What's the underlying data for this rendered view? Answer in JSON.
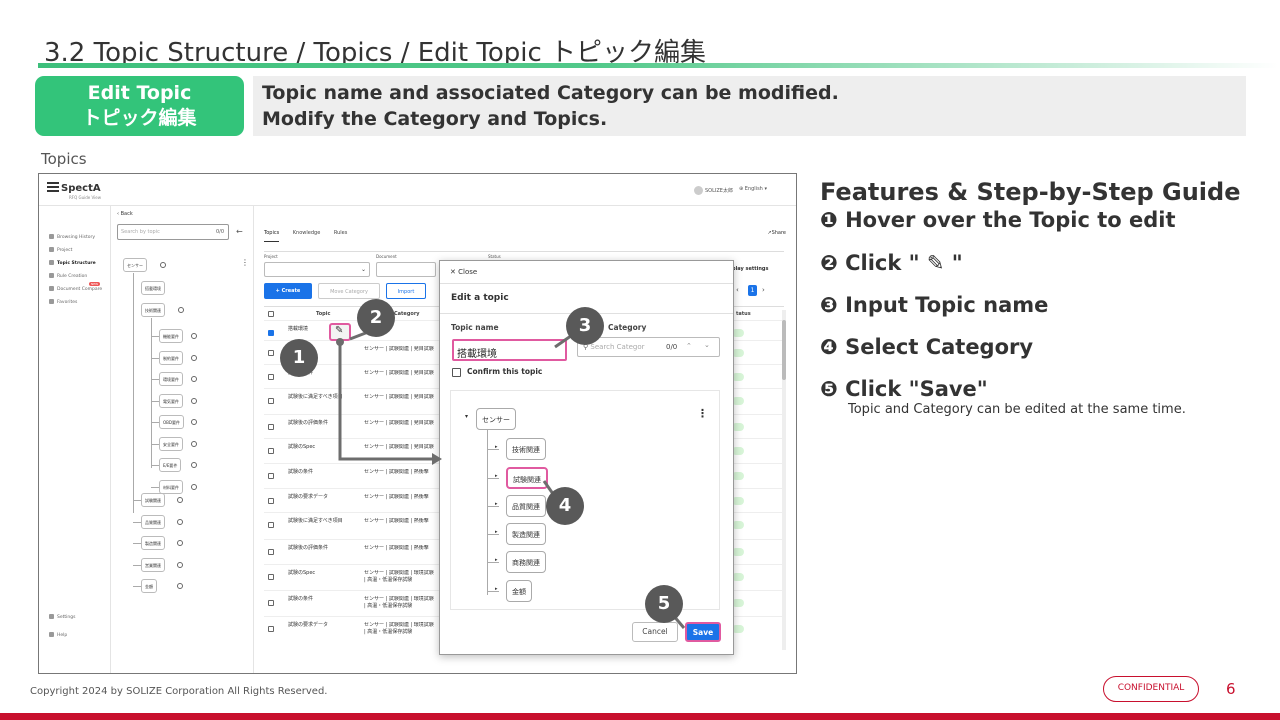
{
  "slide": {
    "title": "3.2 Topic Structure / Topics / Edit Topic トピック編集",
    "badge_line1": "Edit Topic",
    "badge_line2": "トピック編集",
    "desc_line1": "Topic name and associated Category can be modified.",
    "desc_line2": "Modify the Category and Topics.",
    "topics_label": "Topics",
    "copyright": "Copyright 2024 by SOLIZE Corporation All Rights Reserved.",
    "confidential": "CONFIDENTIAL",
    "page_number": "6",
    "accent_color": "#33c47a",
    "brand_red": "#c8102e"
  },
  "guide": {
    "heading": "Features & Step-by-Step Guide",
    "steps": [
      "❶ Hover over the Topic to edit",
      "❷ Click \" ✎ \"",
      "❸ Input Topic name",
      "❹ Select Category",
      "❺ Click \"Save\""
    ],
    "note": "Topic and Category can be edited at the same time."
  },
  "app": {
    "logo": "SpectA",
    "logo_sub": "RFQ Guide View",
    "user": "SOLIZE太郎",
    "language": "English",
    "back": "Back",
    "search_placeholder": "Search by topic",
    "search_count": "0/0",
    "sidebar": [
      "Browsing History",
      "Project",
      "Topic Structure",
      "Rule Creation",
      "Document Compare",
      "Favorites"
    ],
    "sidebar_new": "NEW",
    "settings": "Settings",
    "help": "Help",
    "tree_root": "センサー",
    "tree_l1": "搭載環境",
    "tree_l2": "技術関連",
    "tree_l3": [
      "機能要件",
      "制約要件",
      "環境要件",
      "電気要件",
      "OBD要件",
      "安全要件",
      "E/E要件",
      "材料要件"
    ],
    "tree_l2b": [
      "試験関連",
      "品質関連",
      "製造関連",
      "営業関連",
      "金額"
    ],
    "tabs": [
      "Topics",
      "Knowledge",
      "Rules"
    ],
    "share": "Share",
    "filter_labels": [
      "Project",
      "Document",
      "Status"
    ],
    "create": "Create",
    "move_category": "Move Category",
    "import": "Import",
    "display_settings": "play settings",
    "page": "1",
    "col_topic": "Topic",
    "col_category": "Category",
    "col_status": "tatus",
    "rows": [
      {
        "topic": "搭載環境",
        "category": ""
      },
      {
        "topic": "",
        "category": "センサー | 試験関連 | 発目試験"
      },
      {
        "topic": "試験の条件",
        "category": "センサー | 試験関連 | 発目試験"
      },
      {
        "topic": "試験後に満足すべき項目",
        "category": "センサー | 試験関連 | 発目試験"
      },
      {
        "topic": "試験後の評価条件",
        "category": "センサー | 試験関連 | 発目試験"
      },
      {
        "topic": "試験のSpec",
        "category": "センサー | 試験関連 | 発目試験"
      },
      {
        "topic": "試験の条件",
        "category": "センサー | 試験関連 | 熱衝撃"
      },
      {
        "topic": "試験の要求データ",
        "category": "センサー | 試験関連 | 熱衝撃"
      },
      {
        "topic": "試験後に満足すべき項目",
        "category": "センサー | 試験関連 | 熱衝撃"
      },
      {
        "topic": "試験後の評価条件",
        "category": "センサー | 試験関連 | 熱衝撃"
      },
      {
        "topic": "試験のSpec",
        "category": "センサー | 試験関連 | 環境試験 | 高温・低温保存試験"
      },
      {
        "topic": "試験の条件",
        "category": "センサー | 試験関連 | 環境試験 | 高温・低温保存試験"
      },
      {
        "topic": "試験の要求データ",
        "category": "センサー | 試験関連 | 環境試験 | 高温・低温保存試験"
      }
    ],
    "modal": {
      "close": "Close",
      "title": "Edit a topic",
      "topic_name_label": "Topic name",
      "topic_name_value": "搭載環境",
      "category_label": "Category",
      "category_placeholder": "Search Categor",
      "category_count": "0/0",
      "confirm": "Confirm this topic",
      "tree_root": "センサー",
      "tree_items": [
        "技術関連",
        "試験関連",
        "品質関連",
        "製造関連",
        "商務関連",
        "金額"
      ],
      "cancel": "Cancel",
      "save": "Save"
    }
  },
  "callouts": [
    "1",
    "2",
    "3",
    "4",
    "5"
  ]
}
